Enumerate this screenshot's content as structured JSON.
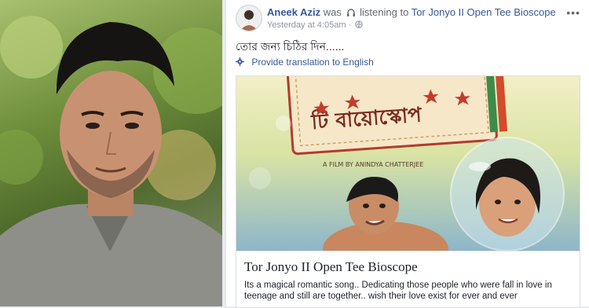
{
  "post": {
    "author": "Aneek Aziz",
    "was_text": "was",
    "activity": "listening to",
    "target": "Tor Jonyo II Open Tee Bioscope",
    "timestamp": "Yesterday at 4:05am",
    "status_text": "তোর জন্য চিঠির দিন......",
    "translate_label": "Provide translation to English",
    "more_label": "•••"
  },
  "attachment": {
    "poster_subtitle": "A FILM BY ANINDYA CHATTERJEE",
    "poster_title": "টি বায়োস্কোপ",
    "title": "Tor Jonyo II Open Tee Bioscope",
    "description": "Its a magical romantic song.. Dedicating those people who were fall in love in teenage and still are together.. wish their love exist for ever and ever"
  },
  "icons": {
    "headphone": "headphone-icon",
    "globe": "globe-icon",
    "gear": "gear-icon"
  },
  "colors": {
    "link": "#365899",
    "text": "#1d2129",
    "muted": "#90949c"
  }
}
